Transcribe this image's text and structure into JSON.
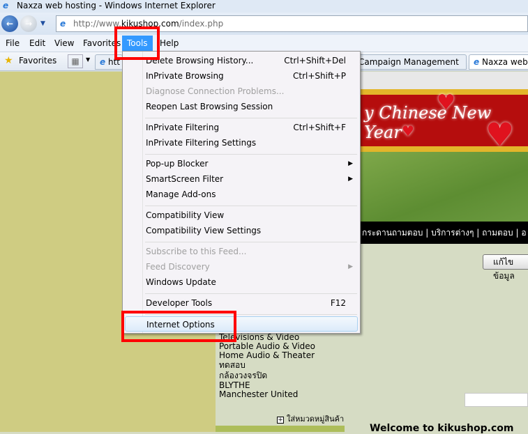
{
  "window": {
    "title": "Naxza web hosting - Windows Internet Explorer"
  },
  "address": {
    "prefix": "http://www.",
    "domain": "kikushop.com",
    "suffix": "/index.php"
  },
  "menubar": [
    "File",
    "Edit",
    "View",
    "Favorites",
    "Tools",
    "Help"
  ],
  "favbar": {
    "favorites": "Favorites",
    "tabs": [
      "htt",
      "Campaign Management",
      "Naxza web h"
    ]
  },
  "tools_menu": {
    "items": [
      {
        "label": "Delete Browsing History...",
        "shortcut": "Ctrl+Shift+Del"
      },
      {
        "label": "InPrivate Browsing",
        "shortcut": "Ctrl+Shift+P"
      },
      {
        "label": "Diagnose Connection Problems...",
        "disabled": true
      },
      {
        "label": "Reopen Last Browsing Session"
      },
      {
        "label": "InPrivate Filtering",
        "shortcut": "Ctrl+Shift+F"
      },
      {
        "label": "InPrivate Filtering Settings"
      },
      {
        "label": "Pop-up Blocker",
        "submenu": true
      },
      {
        "label": "SmartScreen Filter",
        "submenu": true
      },
      {
        "label": "Manage Add-ons"
      },
      {
        "label": "Compatibility View"
      },
      {
        "label": "Compatibility View Settings"
      },
      {
        "label": "Subscribe to this Feed...",
        "disabled": true
      },
      {
        "label": "Feed Discovery",
        "disabled": true,
        "submenu": true
      },
      {
        "label": "Windows Update"
      },
      {
        "label": "Developer Tools",
        "shortcut": "F12"
      },
      {
        "label": "Internet Options",
        "highlighted": true
      }
    ]
  },
  "page": {
    "banner_text": "y Chinese New Year",
    "nav": "กระดานถามตอบ  |  บริการต่างๆ  |  ถามตอบ  |  อ",
    "edit_button": "แก้ไขข้อมูล",
    "categories": [
      "Televisions & Video",
      "Portable Audio & Video",
      "Home Audio & Theater",
      "ทดสอบ",
      "กล้องวงจรปิด",
      "BLYTHE",
      "Manchester United"
    ],
    "add_category": "ใส่หมวดหมู่สินค้า",
    "welcome": "Welcome to kikushop.com"
  },
  "colors": {
    "highlight_box": "#ff0000",
    "menu_selected": "#3399ff"
  }
}
